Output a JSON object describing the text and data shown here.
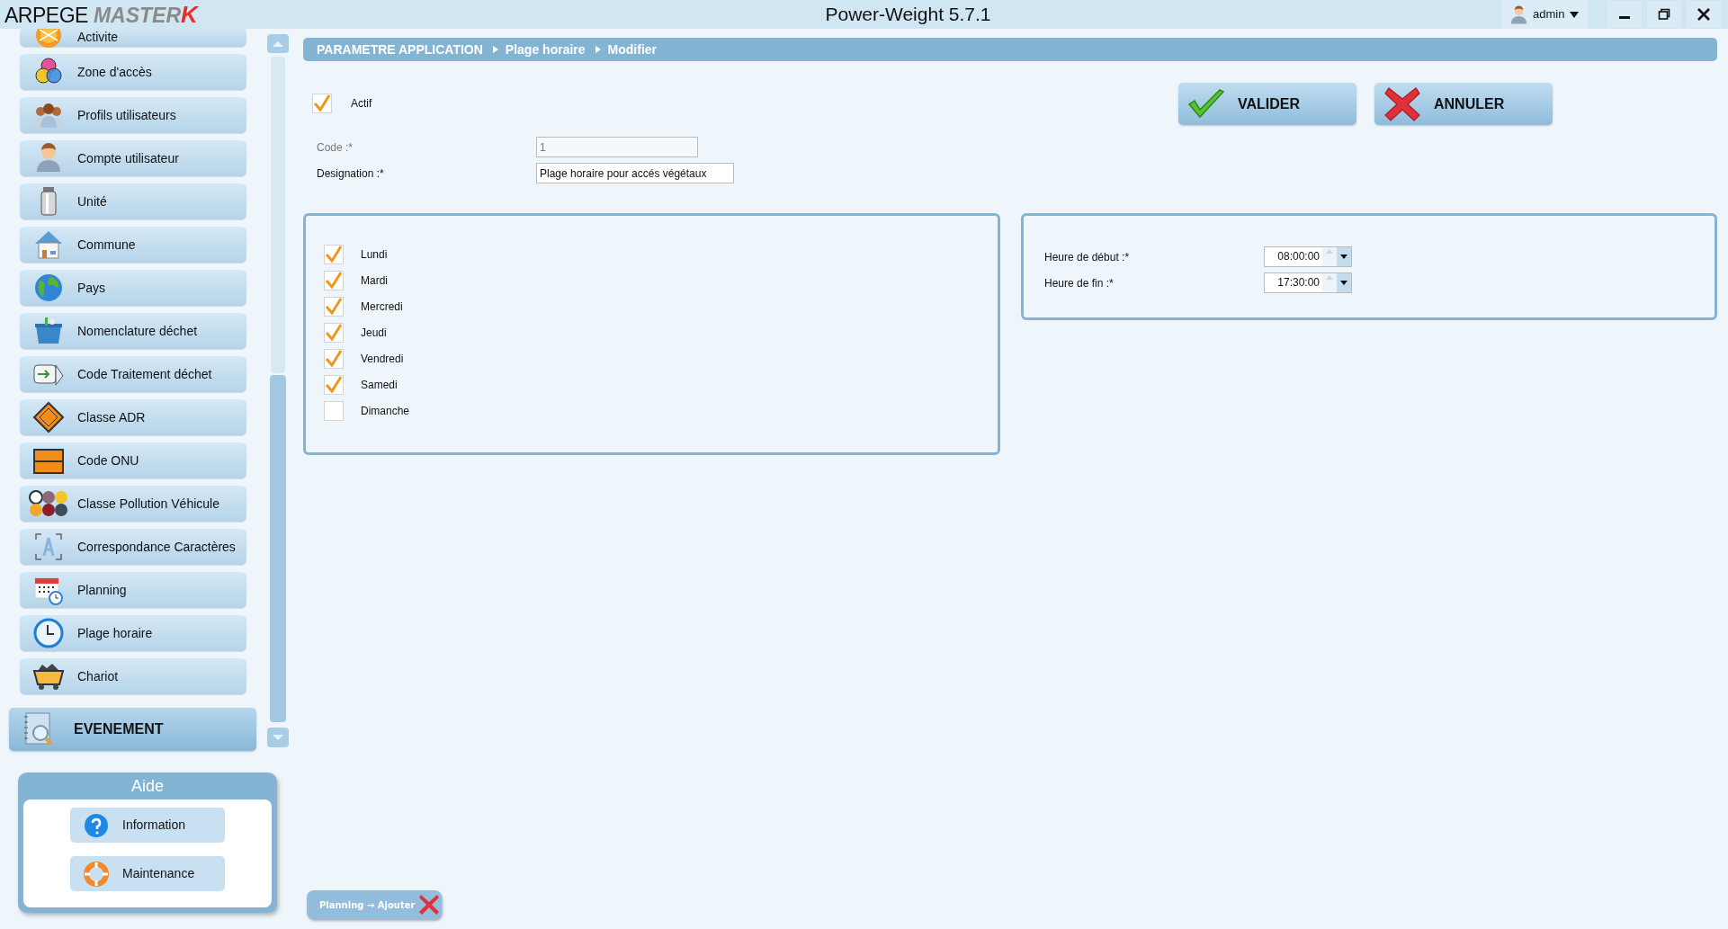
{
  "window": {
    "logo": {
      "text": "ARPEGE",
      "brand": "MASTER",
      "accent": "K"
    },
    "title": "Power-Weight 5.7.1",
    "user": "admin"
  },
  "sidebar": {
    "items": [
      {
        "label": "Activite"
      },
      {
        "label": "Zone d'accès"
      },
      {
        "label": "Profils utilisateurs"
      },
      {
        "label": "Compte utilisateur"
      },
      {
        "label": "Unité"
      },
      {
        "label": "Commune"
      },
      {
        "label": "Pays"
      },
      {
        "label": "Nomenclature déchet"
      },
      {
        "label": "Code Traitement déchet"
      },
      {
        "label": "Classe ADR"
      },
      {
        "label": "Code ONU"
      },
      {
        "label": "Classe Pollution Véhicule"
      },
      {
        "label": "Correspondance Caractères"
      },
      {
        "label": "Planning"
      },
      {
        "label": "Plage horaire"
      },
      {
        "label": "Chariot"
      }
    ],
    "section": "EVENEMENT",
    "help": {
      "title": "Aide",
      "buttons": [
        "Information",
        "Maintenance"
      ]
    }
  },
  "breadcrumb": [
    "PARAMETRE APPLICATION",
    "Plage horaire",
    "Modifier"
  ],
  "form": {
    "active": {
      "label": "Actif",
      "checked": true
    },
    "fields": [
      {
        "label": "Code :*",
        "value": "1",
        "disabled": true
      },
      {
        "label": "Designation :*",
        "value": "Plage horaire pour accés végétaux",
        "disabled": false
      }
    ]
  },
  "actions": [
    {
      "label": "VALIDER",
      "kind": "confirm"
    },
    {
      "label": "ANNULER",
      "kind": "cancel"
    }
  ],
  "days": [
    {
      "label": "Lundi",
      "checked": true
    },
    {
      "label": "Mardi",
      "checked": true
    },
    {
      "label": "Mercredi",
      "checked": true
    },
    {
      "label": "Jeudi",
      "checked": true
    },
    {
      "label": "Vendredi",
      "checked": true
    },
    {
      "label": "Samedi",
      "checked": true
    },
    {
      "label": "Dimanche",
      "checked": false
    }
  ],
  "hours": [
    {
      "label": "Heure de début :*",
      "value": "08:00:00"
    },
    {
      "label": "Heure de fin :*",
      "value": "17:30:00"
    }
  ],
  "open_tabs": [
    {
      "label": "Planning → Ajouter"
    }
  ]
}
